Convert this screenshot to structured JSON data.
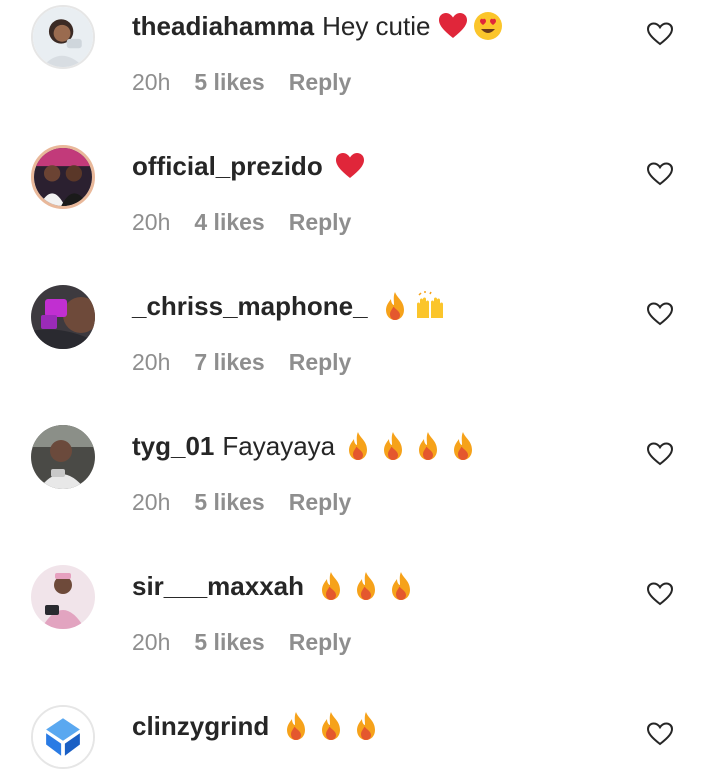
{
  "comments": [
    {
      "username": "theadiahamma",
      "text": "Hey cutie",
      "emoji": [
        "red-heart",
        "heart-eyes"
      ],
      "time": "20h",
      "likes": "5 likes",
      "reply": "Reply"
    },
    {
      "username": "official_prezido",
      "text": "",
      "emoji": [
        "red-heart"
      ],
      "time": "20h",
      "likes": "4 likes",
      "reply": "Reply"
    },
    {
      "username": "_chriss_maphone_",
      "text": "",
      "emoji": [
        "fire",
        "raising-hands"
      ],
      "time": "20h",
      "likes": "7 likes",
      "reply": "Reply"
    },
    {
      "username": "tyg_01",
      "text": "Fayayaya",
      "emoji": [
        "fire",
        "fire",
        "fire",
        "fire"
      ],
      "time": "20h",
      "likes": "5 likes",
      "reply": "Reply"
    },
    {
      "username": "sir___maxxah",
      "text": "",
      "emoji": [
        "fire",
        "fire",
        "fire"
      ],
      "time": "20h",
      "likes": "5 likes",
      "reply": "Reply"
    },
    {
      "username": "clinzygrind",
      "text": "",
      "emoji": [
        "fire",
        "fire",
        "fire"
      ],
      "time": "",
      "likes": "",
      "reply": ""
    }
  ],
  "icons": {
    "like_button": "heart-outline-icon"
  },
  "colors": {
    "username": "#262626",
    "meta": "#8e8e8e",
    "heart": "#e0263a",
    "fire": "#f6a21a"
  }
}
